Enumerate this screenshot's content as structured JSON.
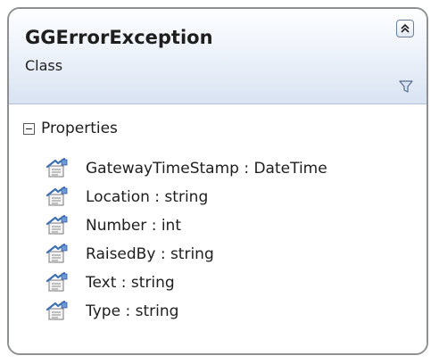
{
  "class": {
    "name": "GGErrorException",
    "kind": "Class"
  },
  "icons": {
    "collapse": "double-chevron-up-icon",
    "filter": "filter-icon",
    "section_toggle": "minus-box-icon",
    "property": "property-icon"
  },
  "properties_section": {
    "title": "Properties",
    "expanded": true,
    "members": [
      {
        "label": "GatewayTimeStamp : DateTime"
      },
      {
        "label": "Location : string"
      },
      {
        "label": "Number : int"
      },
      {
        "label": "RaisedBy : string"
      },
      {
        "label": "Text : string"
      },
      {
        "label": "Type : string"
      }
    ]
  },
  "colors": {
    "border": "#8e9092",
    "header_top": "#fdfeff",
    "header_bottom": "#d9e3f2",
    "text": "#1e1e1e",
    "accent_blue": "#3d6fb4"
  }
}
